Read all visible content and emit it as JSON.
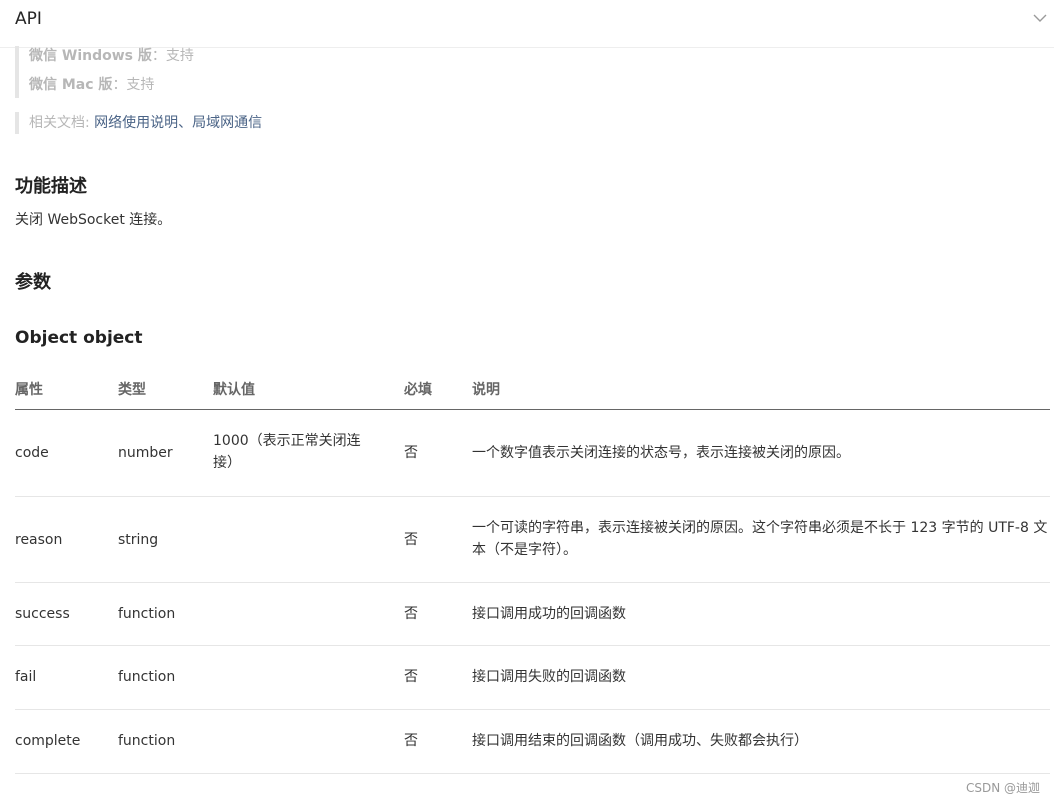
{
  "header": {
    "title": "API"
  },
  "support": {
    "windows_label": "微信 Windows 版",
    "windows_value": "：支持",
    "mac_label": "微信 Mac 版",
    "mac_value": "：支持"
  },
  "related": {
    "label": "相关文档: ",
    "link1": "网络使用说明",
    "sep": "、",
    "link2": "局域网通信"
  },
  "sections": {
    "feature_title": "功能描述",
    "feature_desc": "关闭 WebSocket 连接。",
    "params_title": "参数",
    "object_title": "Object object"
  },
  "table": {
    "headers": [
      "属性",
      "类型",
      "默认值",
      "必填",
      "说明"
    ],
    "rows": [
      {
        "name": "code",
        "type": "number",
        "default": "1000（表示正常关闭连接）",
        "required": "否",
        "desc": "一个数字值表示关闭连接的状态号，表示连接被关闭的原因。"
      },
      {
        "name": "reason",
        "type": "string",
        "default": "",
        "required": "否",
        "desc": "一个可读的字符串，表示连接被关闭的原因。这个字符串必须是不长于 123 字节的 UTF-8 文本（不是字符）。"
      },
      {
        "name": "success",
        "type": "function",
        "default": "",
        "required": "否",
        "desc": "接口调用成功的回调函数"
      },
      {
        "name": "fail",
        "type": "function",
        "default": "",
        "required": "否",
        "desc": "接口调用失败的回调函数"
      },
      {
        "name": "complete",
        "type": "function",
        "default": "",
        "required": "否",
        "desc": "接口调用结束的回调函数（调用成功、失败都会执行）"
      }
    ]
  },
  "footer": {
    "watermark": "CSDN @迪迦"
  }
}
